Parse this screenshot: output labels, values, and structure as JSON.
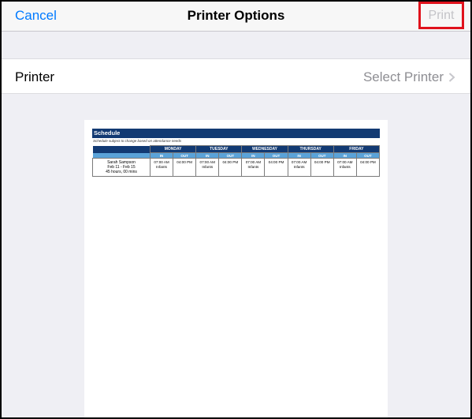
{
  "navbar": {
    "cancel_label": "Cancel",
    "title": "Printer Options",
    "print_label": "Print"
  },
  "printer_row": {
    "label": "Printer",
    "value": "Select Printer"
  },
  "preview": {
    "header_title": "Schedule",
    "note": "Schedule subject to change based on attendance needs",
    "days": [
      "MONDAY",
      "TUESDAY",
      "WEDNESDAY",
      "THURSDAY",
      "FRIDAY"
    ],
    "in_label": "IN",
    "out_label": "OUT",
    "employee": {
      "name": "Sarah Sampson",
      "date_range": "Feb 11 - Feb 15",
      "total": "45 hours, 00 mins"
    },
    "shifts": [
      {
        "in": "07:00 AM",
        "room": "Infants",
        "out": "04:00 PM"
      },
      {
        "in": "07:00 AM",
        "room": "Infants",
        "out": "04:00 PM"
      },
      {
        "in": "07:00 AM",
        "room": "Infants",
        "out": "04:00 PM"
      },
      {
        "in": "07:00 AM",
        "room": "Infants",
        "out": "04:00 PM"
      },
      {
        "in": "07:00 AM",
        "room": "Infants",
        "out": "04:00 PM"
      }
    ]
  }
}
